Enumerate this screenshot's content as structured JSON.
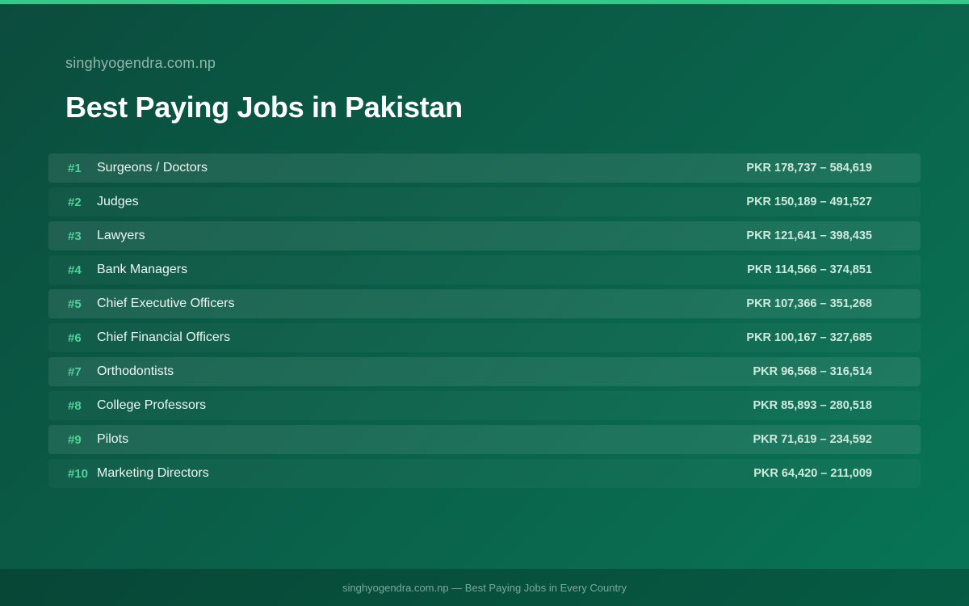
{
  "header": {
    "site": "singhyogendra.com.np",
    "title": "Best Paying Jobs in Pakistan"
  },
  "jobs": [
    {
      "rank": "#1",
      "title": "Surgeons / Doctors",
      "salary": "PKR 178,737 – 584,619"
    },
    {
      "rank": "#2",
      "title": "Judges",
      "salary": "PKR 150,189 – 491,527"
    },
    {
      "rank": "#3",
      "title": "Lawyers",
      "salary": "PKR 121,641 – 398,435"
    },
    {
      "rank": "#4",
      "title": "Bank Managers",
      "salary": "PKR 114,566 – 374,851"
    },
    {
      "rank": "#5",
      "title": "Chief Executive Officers",
      "salary": "PKR 107,366 – 351,268"
    },
    {
      "rank": "#6",
      "title": "Chief Financial Officers",
      "salary": "PKR 100,167 – 327,685"
    },
    {
      "rank": "#7",
      "title": "Orthodontists",
      "salary": "PKR 96,568 – 316,514"
    },
    {
      "rank": "#8",
      "title": "College Professors",
      "salary": "PKR 85,893 – 280,518"
    },
    {
      "rank": "#9",
      "title": "Pilots",
      "salary": "PKR 71,619 – 234,592"
    },
    {
      "rank": "#10",
      "title": "Marketing Directors",
      "salary": "PKR 64,420 – 211,009"
    }
  ],
  "footer": {
    "text": "singhyogendra.com.np — Best Paying Jobs in Every Country"
  },
  "colors": {
    "accent": "#34c98a",
    "rank": "#4fd39a",
    "background_start": "#0b4c3d",
    "background_end": "#087556"
  }
}
